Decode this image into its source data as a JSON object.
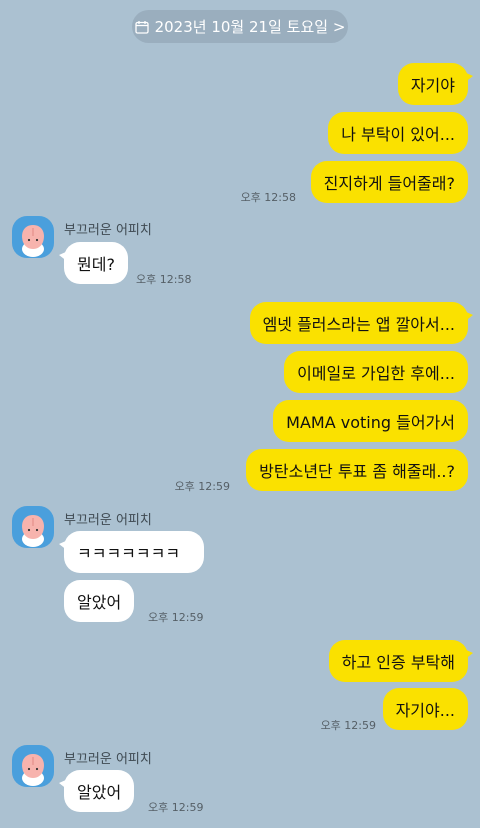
{
  "date_chip": {
    "label": "2023년 10월 21일 토요일 >"
  },
  "sender_name": "부끄러운 어피치",
  "messages": {
    "m1": "자기야",
    "m2": "나 부탁이 있어...",
    "m3": "진지하게 들어줄래?",
    "m4": "뭔데?",
    "m5": "엠넷 플러스라는 앱 깔아서...",
    "m6": "이메일로 가입한 후에...",
    "m7": "MAMA voting 들어가서",
    "m8": "방탄소년단 투표 좀 해줄래..?",
    "m9": "ㅋㅋㅋㅋㅋㅋㅋ",
    "m10": "알았어",
    "m11": "하고 인증 부탁해",
    "m12": "자기야...",
    "m13": "알았어"
  },
  "times": {
    "t1": "오후 12:58",
    "t2": "오후 12:58",
    "t3": "오후 12:59",
    "t4": "오후 12:59",
    "t5": "오후 12:59",
    "t6": "오후 12:59"
  },
  "colors": {
    "background": "#abc1d1",
    "my_bubble": "#fae100",
    "their_bubble": "#ffffff",
    "avatar_bg": "#4a9fdc"
  },
  "icons": {
    "date": "calendar-icon",
    "avatar": "apeach-character-icon"
  }
}
